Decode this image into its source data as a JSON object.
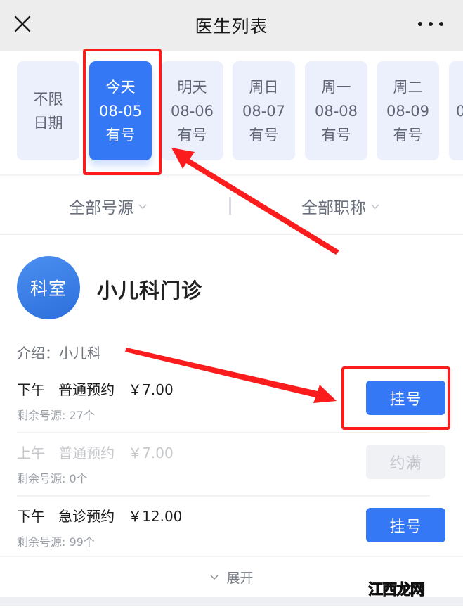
{
  "navbar": {
    "title": "医生列表",
    "close_icon": "close-icon",
    "more_icon": "more-dots-icon"
  },
  "date_strip": {
    "items": [
      {
        "line1": "不限",
        "line2": "日期",
        "line3": "",
        "active": false
      },
      {
        "line1": "今天",
        "line2": "08-05",
        "line3": "有号",
        "active": true
      },
      {
        "line1": "明天",
        "line2": "08-06",
        "line3": "有号",
        "active": false
      },
      {
        "line1": "周日",
        "line2": "08-07",
        "line3": "有号",
        "active": false
      },
      {
        "line1": "周一",
        "line2": "08-08",
        "line3": "有号",
        "active": false
      },
      {
        "line1": "周二",
        "line2": "08-09",
        "line3": "有号",
        "active": false
      },
      {
        "line1": "",
        "line2": "0",
        "line3": "",
        "active": false
      }
    ]
  },
  "filters": {
    "source": "全部号源",
    "title": "全部职称"
  },
  "department": {
    "avatar_text": "科室",
    "name": "小儿科门诊",
    "intro": "介绍：小儿科"
  },
  "slots": [
    {
      "period": "下午",
      "type": "普通预约",
      "price": "￥7.00",
      "remaining": "剩余号源: 27个",
      "button": "挂号",
      "available": true
    },
    {
      "period": "上午",
      "type": "普通预约",
      "price": "￥7.00",
      "remaining": "剩余号源: 0个",
      "button": "约满",
      "available": false
    },
    {
      "period": "下午",
      "type": "急诊预约",
      "price": "￥12.00",
      "remaining": "剩余号源: 99个",
      "button": "挂号",
      "available": true
    }
  ],
  "expand_label": "展开",
  "watermark": {
    "part1": "江",
    "part2": "西",
    "part3": "龙网"
  },
  "colors": {
    "primary": "#3478f6",
    "annotation": "#fb1d1d",
    "date_card_bg": "#ebf0fc",
    "disabled_button_bg": "#f0f1f4"
  }
}
